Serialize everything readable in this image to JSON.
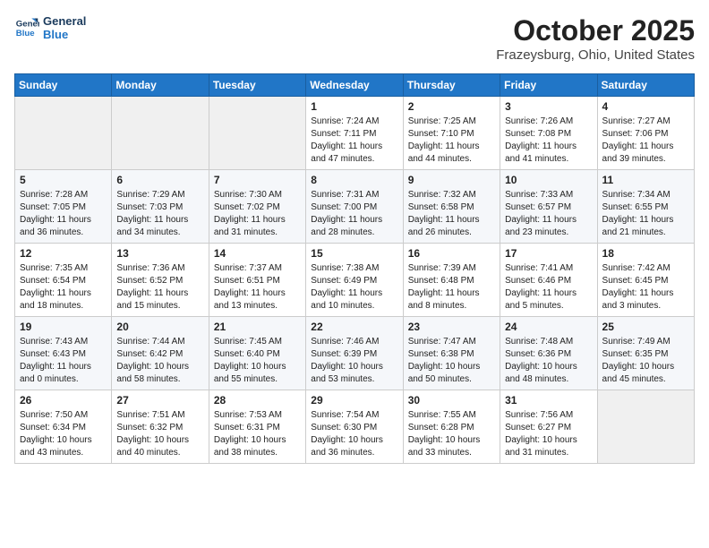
{
  "logo": {
    "line1": "General",
    "line2": "Blue"
  },
  "title": "October 2025",
  "location": "Frazeysburg, Ohio, United States",
  "days_of_week": [
    "Sunday",
    "Monday",
    "Tuesday",
    "Wednesday",
    "Thursday",
    "Friday",
    "Saturday"
  ],
  "weeks": [
    [
      {
        "day": "",
        "content": ""
      },
      {
        "day": "",
        "content": ""
      },
      {
        "day": "",
        "content": ""
      },
      {
        "day": "1",
        "content": "Sunrise: 7:24 AM\nSunset: 7:11 PM\nDaylight: 11 hours\nand 47 minutes."
      },
      {
        "day": "2",
        "content": "Sunrise: 7:25 AM\nSunset: 7:10 PM\nDaylight: 11 hours\nand 44 minutes."
      },
      {
        "day": "3",
        "content": "Sunrise: 7:26 AM\nSunset: 7:08 PM\nDaylight: 11 hours\nand 41 minutes."
      },
      {
        "day": "4",
        "content": "Sunrise: 7:27 AM\nSunset: 7:06 PM\nDaylight: 11 hours\nand 39 minutes."
      }
    ],
    [
      {
        "day": "5",
        "content": "Sunrise: 7:28 AM\nSunset: 7:05 PM\nDaylight: 11 hours\nand 36 minutes."
      },
      {
        "day": "6",
        "content": "Sunrise: 7:29 AM\nSunset: 7:03 PM\nDaylight: 11 hours\nand 34 minutes."
      },
      {
        "day": "7",
        "content": "Sunrise: 7:30 AM\nSunset: 7:02 PM\nDaylight: 11 hours\nand 31 minutes."
      },
      {
        "day": "8",
        "content": "Sunrise: 7:31 AM\nSunset: 7:00 PM\nDaylight: 11 hours\nand 28 minutes."
      },
      {
        "day": "9",
        "content": "Sunrise: 7:32 AM\nSunset: 6:58 PM\nDaylight: 11 hours\nand 26 minutes."
      },
      {
        "day": "10",
        "content": "Sunrise: 7:33 AM\nSunset: 6:57 PM\nDaylight: 11 hours\nand 23 minutes."
      },
      {
        "day": "11",
        "content": "Sunrise: 7:34 AM\nSunset: 6:55 PM\nDaylight: 11 hours\nand 21 minutes."
      }
    ],
    [
      {
        "day": "12",
        "content": "Sunrise: 7:35 AM\nSunset: 6:54 PM\nDaylight: 11 hours\nand 18 minutes."
      },
      {
        "day": "13",
        "content": "Sunrise: 7:36 AM\nSunset: 6:52 PM\nDaylight: 11 hours\nand 15 minutes."
      },
      {
        "day": "14",
        "content": "Sunrise: 7:37 AM\nSunset: 6:51 PM\nDaylight: 11 hours\nand 13 minutes."
      },
      {
        "day": "15",
        "content": "Sunrise: 7:38 AM\nSunset: 6:49 PM\nDaylight: 11 hours\nand 10 minutes."
      },
      {
        "day": "16",
        "content": "Sunrise: 7:39 AM\nSunset: 6:48 PM\nDaylight: 11 hours\nand 8 minutes."
      },
      {
        "day": "17",
        "content": "Sunrise: 7:41 AM\nSunset: 6:46 PM\nDaylight: 11 hours\nand 5 minutes."
      },
      {
        "day": "18",
        "content": "Sunrise: 7:42 AM\nSunset: 6:45 PM\nDaylight: 11 hours\nand 3 minutes."
      }
    ],
    [
      {
        "day": "19",
        "content": "Sunrise: 7:43 AM\nSunset: 6:43 PM\nDaylight: 11 hours\nand 0 minutes."
      },
      {
        "day": "20",
        "content": "Sunrise: 7:44 AM\nSunset: 6:42 PM\nDaylight: 10 hours\nand 58 minutes."
      },
      {
        "day": "21",
        "content": "Sunrise: 7:45 AM\nSunset: 6:40 PM\nDaylight: 10 hours\nand 55 minutes."
      },
      {
        "day": "22",
        "content": "Sunrise: 7:46 AM\nSunset: 6:39 PM\nDaylight: 10 hours\nand 53 minutes."
      },
      {
        "day": "23",
        "content": "Sunrise: 7:47 AM\nSunset: 6:38 PM\nDaylight: 10 hours\nand 50 minutes."
      },
      {
        "day": "24",
        "content": "Sunrise: 7:48 AM\nSunset: 6:36 PM\nDaylight: 10 hours\nand 48 minutes."
      },
      {
        "day": "25",
        "content": "Sunrise: 7:49 AM\nSunset: 6:35 PM\nDaylight: 10 hours\nand 45 minutes."
      }
    ],
    [
      {
        "day": "26",
        "content": "Sunrise: 7:50 AM\nSunset: 6:34 PM\nDaylight: 10 hours\nand 43 minutes."
      },
      {
        "day": "27",
        "content": "Sunrise: 7:51 AM\nSunset: 6:32 PM\nDaylight: 10 hours\nand 40 minutes."
      },
      {
        "day": "28",
        "content": "Sunrise: 7:53 AM\nSunset: 6:31 PM\nDaylight: 10 hours\nand 38 minutes."
      },
      {
        "day": "29",
        "content": "Sunrise: 7:54 AM\nSunset: 6:30 PM\nDaylight: 10 hours\nand 36 minutes."
      },
      {
        "day": "30",
        "content": "Sunrise: 7:55 AM\nSunset: 6:28 PM\nDaylight: 10 hours\nand 33 minutes."
      },
      {
        "day": "31",
        "content": "Sunrise: 7:56 AM\nSunset: 6:27 PM\nDaylight: 10 hours\nand 31 minutes."
      },
      {
        "day": "",
        "content": ""
      }
    ]
  ]
}
